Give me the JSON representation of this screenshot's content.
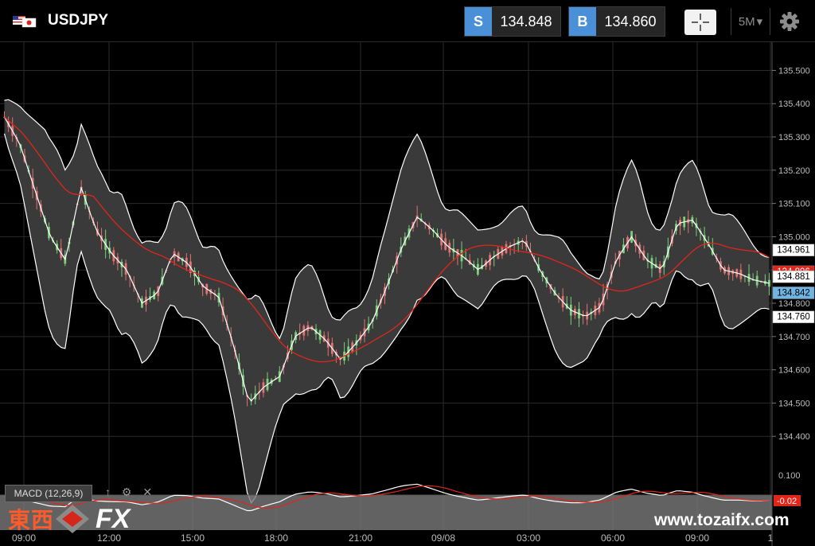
{
  "header": {
    "symbol": "USDJPY",
    "flag": "us-jp-flag-icon",
    "sell_tag": "S",
    "sell_price": "134.848",
    "buy_tag": "B",
    "buy_price": "134.860",
    "crosshair": "crosshair-icon",
    "timeframe": "5M",
    "timeframe_arrow": "▾",
    "settings": "gear-icon"
  },
  "chart_data": {
    "type": "candlestick",
    "instrument": "USDJPY",
    "timeframe": "5M",
    "ylim": [
      134.3,
      135.58
    ],
    "y_ticks": [
      "135.500",
      "135.400",
      "135.300",
      "135.200",
      "135.100",
      "135.000",
      "134.900",
      "134.800",
      "134.700",
      "134.600",
      "134.500",
      "134.400"
    ],
    "x_ticks": [
      "09:00",
      "12:00",
      "15:00",
      "18:00",
      "21:00",
      "09/08",
      "03:00",
      "06:00",
      "09:00",
      "1"
    ],
    "price_labels": [
      {
        "value": "134.961",
        "color": "#ffffff",
        "text_color": "#000000"
      },
      {
        "value": "134.896",
        "color": "#e0261a",
        "text_color": "#ffffff"
      },
      {
        "value": "134.881",
        "color": "#ffffff",
        "text_color": "#000000"
      },
      {
        "value": "134.842",
        "color": "#6fb6e6",
        "text_color": "#000000"
      },
      {
        "value": "134.760",
        "color": "#ffffff",
        "text_color": "#000000"
      }
    ],
    "mid_price_series": [
      135.36,
      135.28,
      135.14,
      135.0,
      134.93,
      135.15,
      135.02,
      134.95,
      134.9,
      134.8,
      134.83,
      134.95,
      134.92,
      134.85,
      134.82,
      134.67,
      134.5,
      134.55,
      134.58,
      134.7,
      134.73,
      134.69,
      134.63,
      134.68,
      134.74,
      134.85,
      134.97,
      135.06,
      135.02,
      134.97,
      134.94,
      134.9,
      134.94,
      134.97,
      134.99,
      134.9,
      134.83,
      134.78,
      134.76,
      134.79,
      134.93,
      135.0,
      134.93,
      134.9,
      135.04,
      135.05,
      134.98,
      134.9,
      134.89,
      134.87,
      134.86
    ],
    "indicators": {
      "bollinger": {
        "upper_color": "#ffffff",
        "lower_color": "#ffffff",
        "middle_color": "#ffffff",
        "fill": "#3a3a3a"
      },
      "moving_average": {
        "color": "#e0261a"
      },
      "macd": {
        "label": "MACD (12,26,9)",
        "macd_color": "#ffffff",
        "signal_color": "#e0261a",
        "ticks": [
          "0.100",
          "-0.02"
        ]
      }
    },
    "colors": {
      "up": "#7bd17b",
      "down": "#e27373",
      "grid": "#2a2a2a",
      "bg": "#000000"
    }
  },
  "macd_panel": {
    "label": "MACD (12,26,9)",
    "icons": [
      "up-arrow-icon",
      "gear-icon",
      "close-icon"
    ]
  },
  "watermark": {
    "kanji": "東西",
    "fx": "FX",
    "url": "www.tozaifx.com"
  }
}
